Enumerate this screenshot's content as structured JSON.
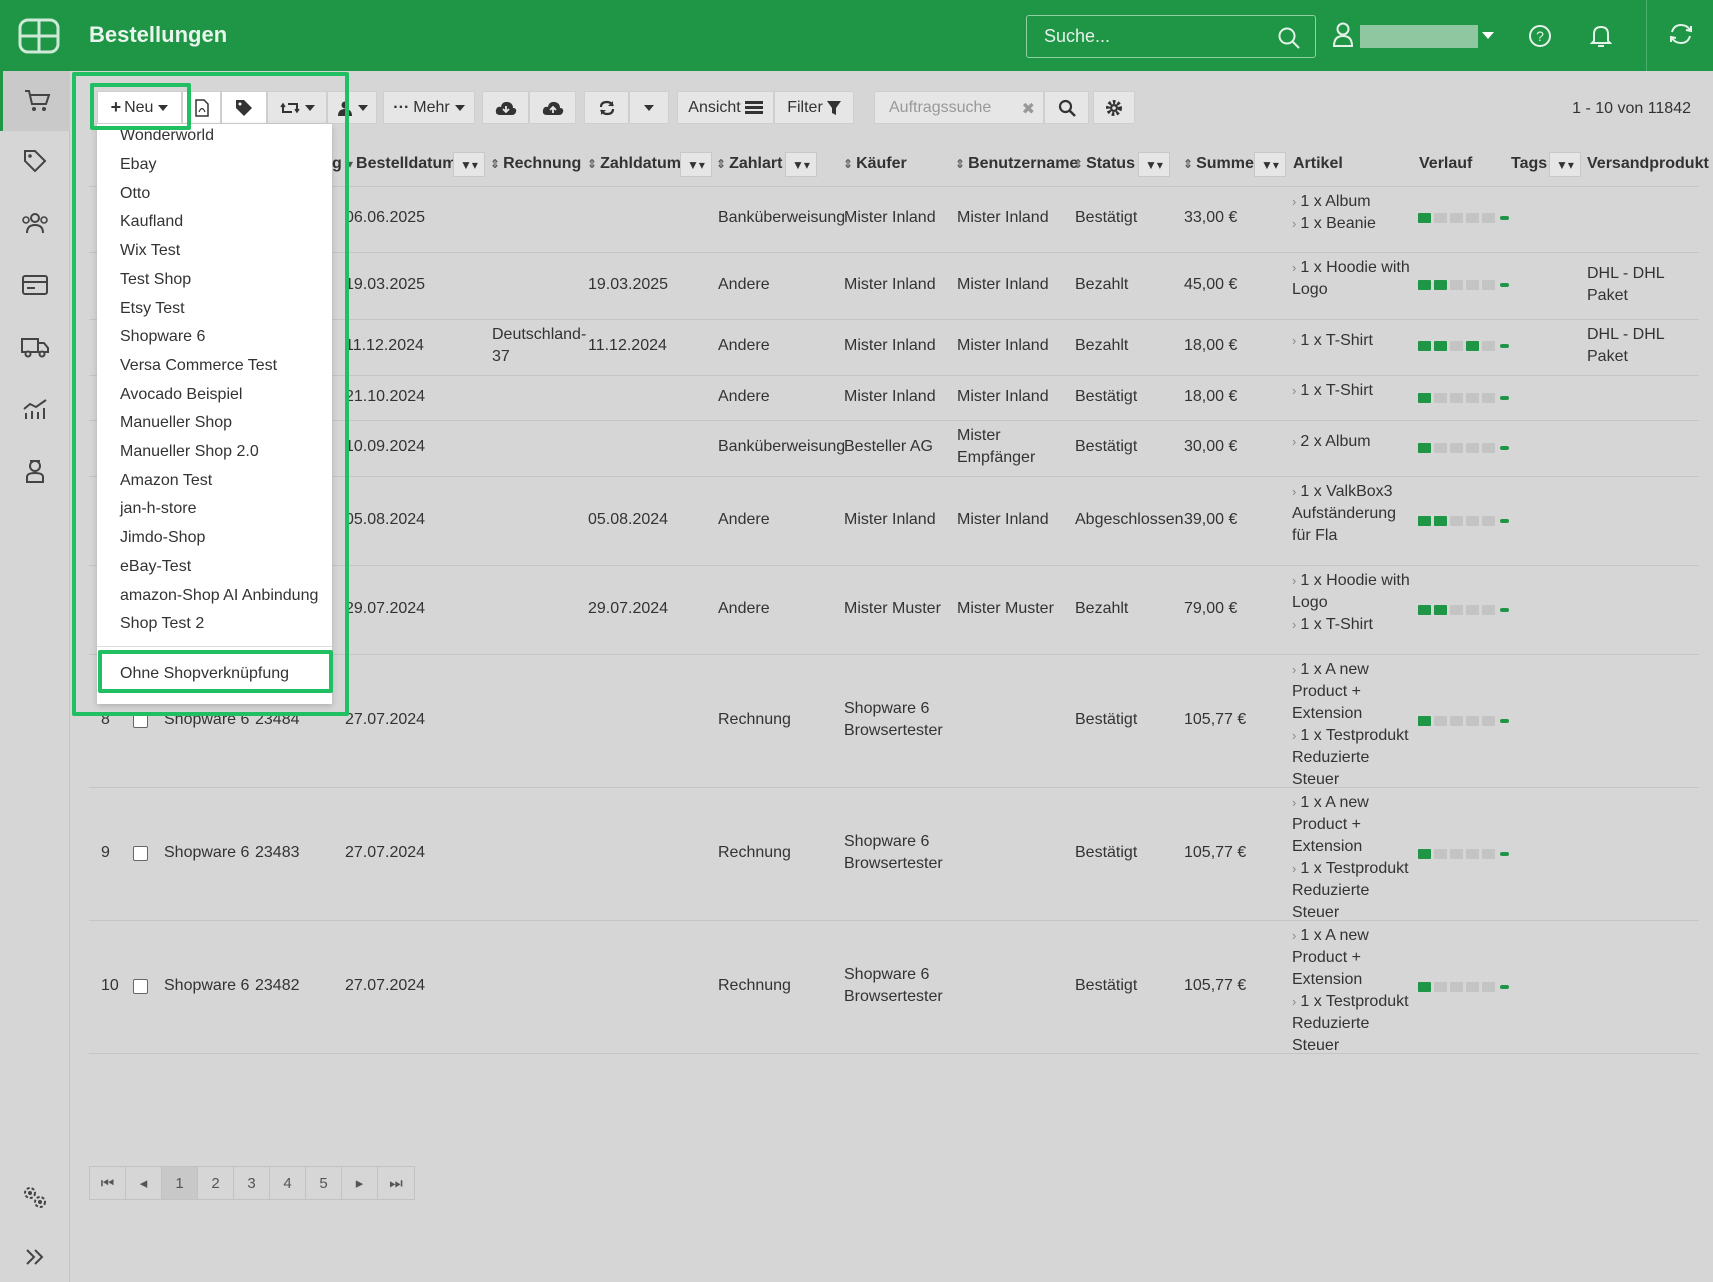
{
  "header": {
    "title": "Bestellungen",
    "search_placeholder": "Suche...",
    "icons": [
      "logo-icon",
      "search-icon",
      "user-icon",
      "help-icon",
      "bell-icon",
      "sync-icon"
    ]
  },
  "sidebar": {
    "items": [
      "cart-icon",
      "tags-icon",
      "customers-icon",
      "payments-icon",
      "shipping-icon",
      "statistics-icon",
      "support-icon"
    ],
    "bottom": [
      "settings-icon",
      "expand-icon"
    ]
  },
  "toolbar": {
    "new_label": "Neu",
    "more_label": "Mehr",
    "view_label": "Ansicht",
    "filter_label": "Filter",
    "order_search_placeholder": "Auftragssuche",
    "range": "1 - 10 von 11842"
  },
  "table": {
    "headers": {
      "shop_partial": "g",
      "bestelldatum": "Bestelldatum",
      "rechnung": "Rechnung",
      "zahldatum": "Zahldatum",
      "zahlart": "Zahlart",
      "kaeufer": "Käufer",
      "benutzername": "Benutzername",
      "status": "Status",
      "summe": "Summe",
      "artikel": "Artikel",
      "verlauf": "Verlauf",
      "tags": "Tags",
      "versandprodukt": "Versandprodukt"
    },
    "rows": [
      {
        "num": "",
        "shop": "",
        "order": "",
        "date": "06.06.2025",
        "invoice": "",
        "paydate": "",
        "payment": "Banküberweisung",
        "buyer": "Mister Inland",
        "user": "Mister Inland",
        "status": "Bestätigt",
        "sum": "33,00 €",
        "articles": [
          "1 x Album",
          "1 x Beanie"
        ],
        "shipping": ""
      },
      {
        "num": "",
        "shop": "",
        "order": "",
        "date": "19.03.2025",
        "invoice": "",
        "paydate": "19.03.2025",
        "payment": "Andere",
        "buyer": "Mister Inland",
        "user": "Mister Inland",
        "status": "Bezahlt",
        "sum": "45,00 €",
        "articles": [
          "1 x Hoodie with Logo"
        ],
        "shipping": "DHL - DHL Paket"
      },
      {
        "num": "",
        "shop": "",
        "order": "",
        "date": "11.12.2024",
        "invoice": "Deutschland-37",
        "paydate": "11.12.2024",
        "payment": "Andere",
        "buyer": "Mister Inland",
        "user": "Mister Inland",
        "status": "Bezahlt",
        "sum": "18,00 €",
        "articles": [
          "1 x T-Shirt"
        ],
        "shipping": "DHL - DHL Paket"
      },
      {
        "num": "",
        "shop": "",
        "order": "",
        "date": "21.10.2024",
        "invoice": "",
        "paydate": "",
        "payment": "Andere",
        "buyer": "Mister Inland",
        "user": "Mister Inland",
        "status": "Bestätigt",
        "sum": "18,00 €",
        "articles": [
          "1 x T-Shirt"
        ],
        "shipping": ""
      },
      {
        "num": "",
        "shop": "",
        "order": "",
        "date": "10.09.2024",
        "invoice": "",
        "paydate": "",
        "payment": "Banküberweisung",
        "buyer": "Besteller AG",
        "user": "Mister Empfänger",
        "status": "Bestätigt",
        "sum": "30,00 €",
        "articles": [
          "2 x Album"
        ],
        "shipping": ""
      },
      {
        "num": "",
        "shop": "",
        "order": "",
        "date": "05.08.2024",
        "invoice": "",
        "paydate": "05.08.2024",
        "payment": "Andere",
        "buyer": "Mister Inland",
        "user": "Mister Inland",
        "status": "Abgeschlossen",
        "sum": "39,00 €",
        "articles": [
          "1 x ValkBox3 Aufständerung für Fla"
        ],
        "shipping": ""
      },
      {
        "num": "",
        "shop": "",
        "order": "",
        "date": "29.07.2024",
        "invoice": "",
        "paydate": "29.07.2024",
        "payment": "Andere",
        "buyer": "Mister Muster",
        "user": "Mister Muster",
        "status": "Bezahlt",
        "sum": "79,00 €",
        "articles": [
          "1 x Hoodie with Logo",
          "1 x T-Shirt"
        ],
        "shipping": ""
      },
      {
        "num": "8",
        "shop": "Shopware 6",
        "order": "23484",
        "date": "27.07.2024",
        "invoice": "",
        "paydate": "",
        "payment": "Rechnung",
        "buyer": "Shopware 6 Browsertester",
        "user": "",
        "status": "Bestätigt",
        "sum": "105,77 €",
        "articles": [
          "1 x A new Product + Extension",
          "1 x Testprodukt Reduzierte Steuer"
        ],
        "shipping": ""
      },
      {
        "num": "9",
        "shop": "Shopware 6",
        "order": "23483",
        "date": "27.07.2024",
        "invoice": "",
        "paydate": "",
        "payment": "Rechnung",
        "buyer": "Shopware 6 Browsertester",
        "user": "",
        "status": "Bestätigt",
        "sum": "105,77 €",
        "articles": [
          "1 x A new Product + Extension",
          "1 x Testprodukt Reduzierte Steuer"
        ],
        "shipping": ""
      },
      {
        "num": "10",
        "shop": "Shopware 6",
        "order": "23482",
        "date": "27.07.2024",
        "invoice": "",
        "paydate": "",
        "payment": "Rechnung",
        "buyer": "Shopware 6 Browsertester",
        "user": "",
        "status": "Bestätigt",
        "sum": "105,77 €",
        "articles": [
          "1 x A new Product + Extension",
          "1 x Testprodukt Reduzierte Steuer"
        ],
        "shipping": ""
      }
    ]
  },
  "pagination": {
    "pages": [
      "1",
      "2",
      "3",
      "4",
      "5"
    ],
    "current": "1"
  },
  "dropdown": {
    "shops": [
      "Wonderworld",
      "Ebay",
      "Otto",
      "Kaufland",
      "Wix Test",
      "Test Shop",
      "Etsy Test",
      "Shopware 6",
      "Versa Commerce Test",
      "Avocado Beispiel",
      "Manueller Shop",
      "Manueller Shop 2.0",
      "Amazon Test",
      "jan-h-store",
      "Jimdo-Shop",
      "eBay-Test",
      "amazon-Shop AI Anbindung",
      "Shop Test 2"
    ],
    "no_shop": "Ohne Shopverknüpfung"
  },
  "colors": {
    "brand": "#1f9546",
    "highlight": "#1fbf62"
  }
}
